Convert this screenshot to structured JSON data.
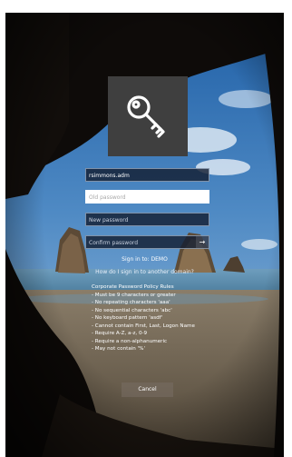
{
  "login": {
    "username_value": "rsimmons.adm",
    "old_password_placeholder": "Old password",
    "new_password_placeholder": "New password",
    "confirm_password_placeholder": "Confirm password",
    "submit_icon": "arrow-right-icon"
  },
  "sign_in_to": "Sign in to: DEMO",
  "other_domain_link": "How do I sign in to another domain?",
  "policy": {
    "title": "Corporate Password Policy Rules",
    "rules": [
      "- Must be 9 characters or greater",
      "- No repeating characters 'aaa'",
      "- No sequential characters 'abc'",
      "- No keyboard pattern 'asdf'",
      "- Cannot contain First, Last, Logon Name",
      "- Require A-Z, a-z, 0-9",
      "- Require a non-alphanumeric",
      "- May not contain '%'"
    ]
  },
  "cancel_label": "Cancel",
  "tile_icon": "key-icon"
}
